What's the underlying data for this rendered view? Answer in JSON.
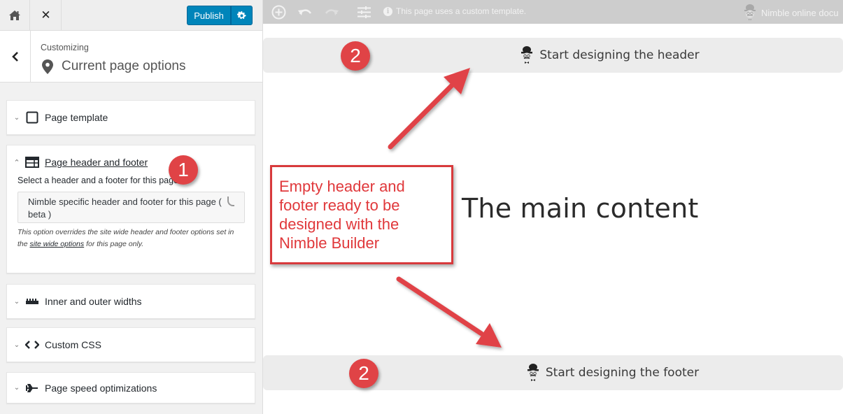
{
  "sidebar": {
    "topbar": {
      "home_icon": "home-icon",
      "close_icon": "close-icon",
      "close_glyph": "✕",
      "publish_label": "Publish",
      "settings_icon": "gear-icon"
    },
    "section": {
      "back_icon": "chevron-left-icon",
      "customizing_label": "Customizing",
      "title": "Current page options",
      "title_icon": "map-pin-icon"
    },
    "panels": [
      {
        "title": "Page template",
        "icon": "square-icon",
        "expanded": false
      },
      {
        "title": "Page header and footer",
        "icon": "layout-icon",
        "expanded": true,
        "select_label": "Select a header and a footer for this page",
        "select_value": "Nimble specific header and footer for this page ( beta )",
        "help_before": "This option overrides the site wide header and footer options set in the ",
        "help_link": "site wide options",
        "help_after": " for this page only."
      },
      {
        "title": "Inner and outer widths",
        "icon": "ruler-icon",
        "expanded": false
      },
      {
        "title": "Custom CSS",
        "icon": "code-icon",
        "expanded": false
      },
      {
        "title": "Page speed optimizations",
        "icon": "airplane-icon",
        "expanded": false
      }
    ]
  },
  "preview": {
    "topbar": {
      "add_icon": "plus-circle-icon",
      "undo_icon": "undo-icon",
      "redo_icon": "redo-icon",
      "settings_icon": "sliders-icon",
      "notice": "This page uses a custom template.",
      "docs_label": "Nimble online docu"
    },
    "header_cta": "Start designing the header",
    "footer_cta": "Start designing the footer",
    "main_content": "The main content"
  },
  "annotations": {
    "badge_1": "1",
    "badge_2_header": "2",
    "badge_2_footer": "2",
    "callout": "Empty header and footer ready to be designed with the Nimble Builder",
    "color": "#e04346"
  }
}
